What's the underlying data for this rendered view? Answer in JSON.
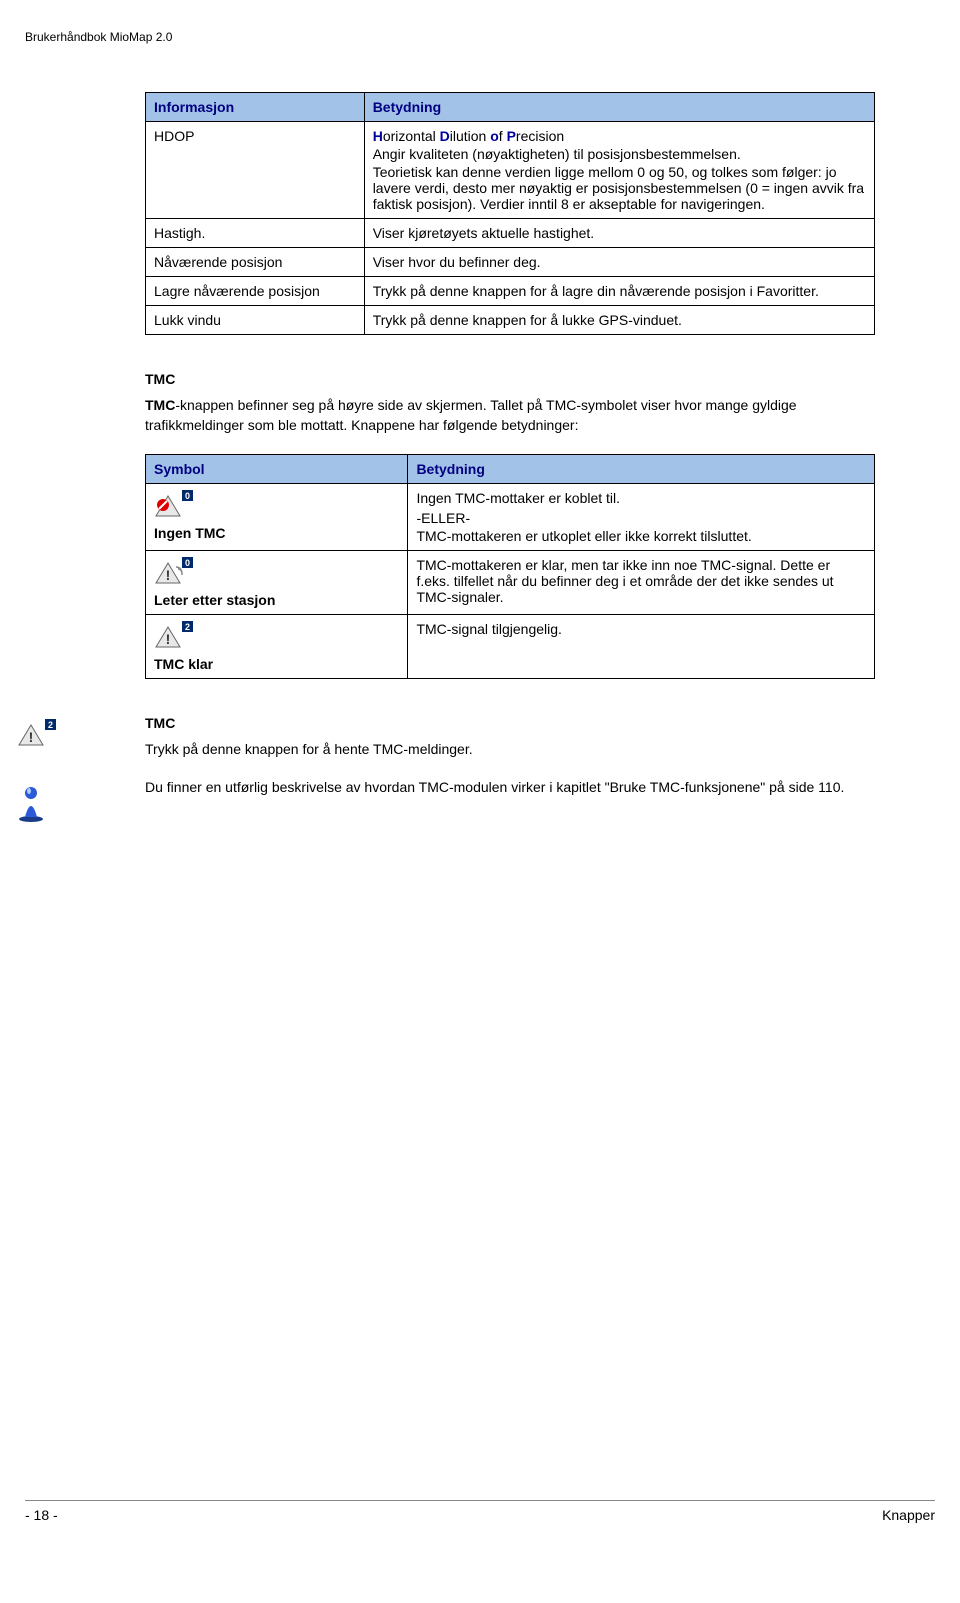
{
  "header": "Brukerhåndbok MioMap 2.0",
  "table1": {
    "headers": [
      "Informasjon",
      "Betydning"
    ],
    "rows": [
      {
        "c0": "HDOP",
        "c1_pre": "",
        "c1_h": "H",
        "c1_t1": "orizontal ",
        "c1_d": "D",
        "c1_t2": "ilution ",
        "c1_o": "o",
        "c1_t3": "f ",
        "c1_p": "P",
        "c1_t4": "recision",
        "c1_rest": "Angir kvaliteten (nøyaktigheten) til posisjonsbestemmelsen.",
        "c1_rest2": "Teorietisk kan denne verdien ligge mellom 0 og 50, og tolkes som følger: jo lavere verdi, desto mer nøyaktig er posisjonsbestemmelsen (0 = ingen avvik fra faktisk posisjon). Verdier inntil 8 er akseptable for navigeringen."
      },
      {
        "c0": "Hastigh.",
        "c1": "Viser kjøretøyets aktuelle hastighet."
      },
      {
        "c0": "Nåværende posisjon",
        "c1": "Viser hvor du befinner deg."
      },
      {
        "c0": "Lagre nåværende posisjon",
        "c1": "Trykk på denne knappen for å lagre din nåværende posisjon i Favoritter."
      },
      {
        "c0": "Lukk vindu",
        "c1": "Trykk på denne knappen for å lukke GPS-vinduet."
      }
    ]
  },
  "tmc_title": "TMC",
  "tmc_para": "TMC-knappen befinner seg på høyre side av skjermen. Tallet på TMC-symbolet viser hvor mange gyldige trafikkmeldinger som ble mottatt. Knappene har følgende betydninger:",
  "table2": {
    "headers": [
      "Symbol",
      "Betydning"
    ],
    "rows": [
      {
        "label": "Ingen TMC",
        "badge": "0",
        "c1a": "Ingen TMC-mottaker er koblet til.",
        "c1b": "-ELLER-",
        "c1c": "TMC-mottakeren er utkoplet eller ikke korrekt tilsluttet."
      },
      {
        "label": "Leter etter stasjon",
        "badge": "0",
        "c1": "TMC-mottakeren er klar, men tar ikke inn noe TMC-signal. Dette er f.eks. tilfellet når du befinner deg i et område der det ikke sendes ut TMC-signaler."
      },
      {
        "label": "TMC klar",
        "badge": "2",
        "c1": "TMC-signal tilgjengelig."
      }
    ]
  },
  "tmc2_title": "TMC",
  "tmc2_p1": "Trykk på denne knappen for å hente TMC-meldinger.",
  "tmc2_p2": "Du finner en utførlig beskrivelse av hvordan TMC-modulen virker i kapitlet \"Bruke TMC-funksjonene\" på side 110.",
  "footer": {
    "left": "- 18 -",
    "right": "Knapper"
  }
}
